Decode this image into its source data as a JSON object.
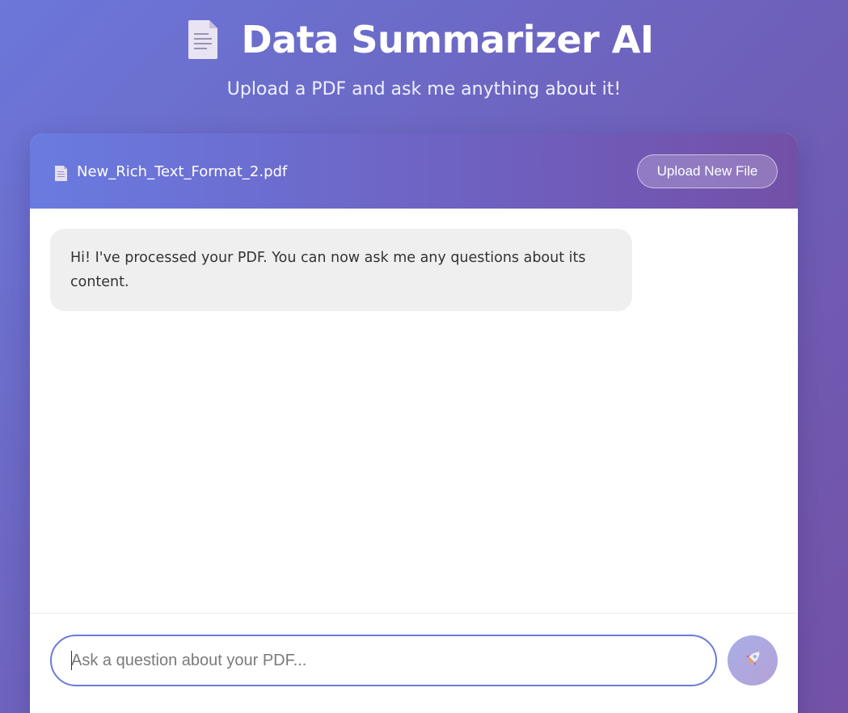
{
  "app": {
    "title": "Data Summarizer AI",
    "subtitle": "Upload a PDF and ask me anything about it!",
    "title_icon": "document-icon"
  },
  "file_bar": {
    "file_icon": "document-icon",
    "file_name": "New_Rich_Text_Format_2.pdf",
    "upload_label": "Upload New File"
  },
  "chat": {
    "messages": [
      {
        "role": "assistant",
        "text": "Hi! I've processed your PDF. You can now ask me any questions about its content."
      }
    ]
  },
  "composer": {
    "placeholder": "Ask a question about your PDF...",
    "value": "",
    "send_icon": "rocket-icon"
  },
  "colors": {
    "accent": "#6a7bd6",
    "header_gradient_start": "#6a7be0",
    "header_gradient_end": "#7350a8",
    "bubble_bg": "#efefef"
  }
}
